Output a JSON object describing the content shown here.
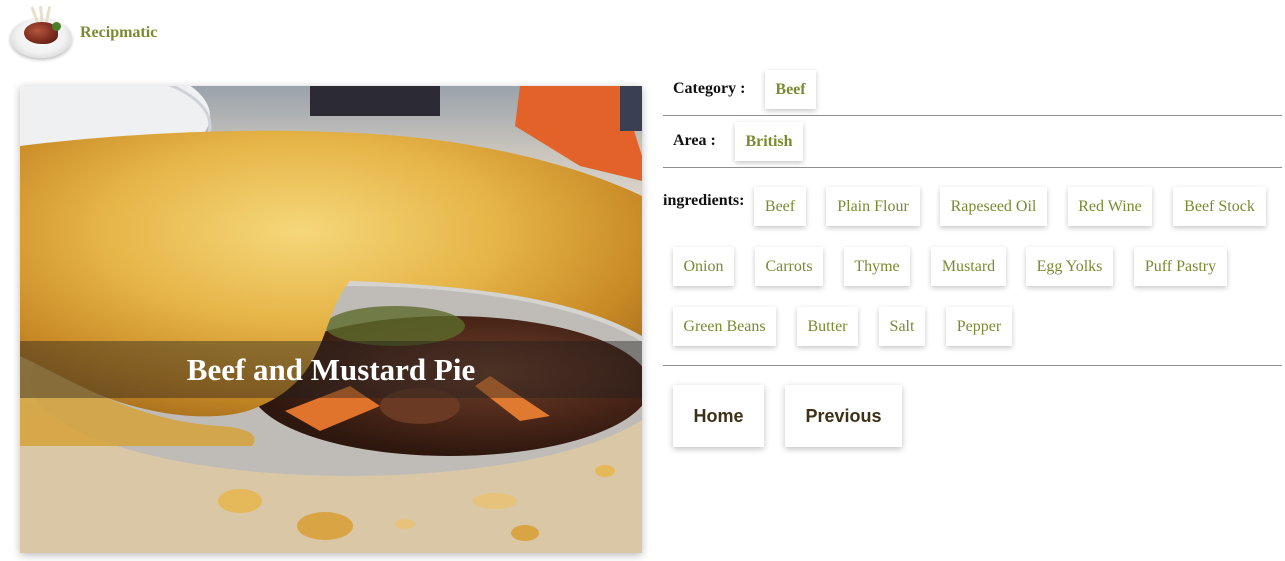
{
  "brand": {
    "name": "Recipmatic",
    "logo_icon": "plate-with-lamb-chops-icon"
  },
  "meal": {
    "title": "Beef and Mustard Pie",
    "image_icon": "beef-pie-photo"
  },
  "category": {
    "label": "Category :",
    "value": "Beef"
  },
  "area": {
    "label": "Area :",
    "value": "British"
  },
  "ingredients": {
    "label": "ingredients:",
    "items": [
      "Beef",
      "Plain Flour",
      "Rapeseed Oil",
      "Red Wine",
      "Beef Stock",
      "Onion",
      "Carrots",
      "Thyme",
      "Mustard",
      "Egg Yolks",
      "Puff Pastry",
      "Green Beans",
      "Butter",
      "Salt",
      "Pepper"
    ]
  },
  "nav": {
    "home_label": "Home",
    "previous_label": "Previous"
  },
  "colors": {
    "accent": "#7b8a32",
    "button_text": "#3d3217",
    "divider": "#8e8e8e"
  }
}
